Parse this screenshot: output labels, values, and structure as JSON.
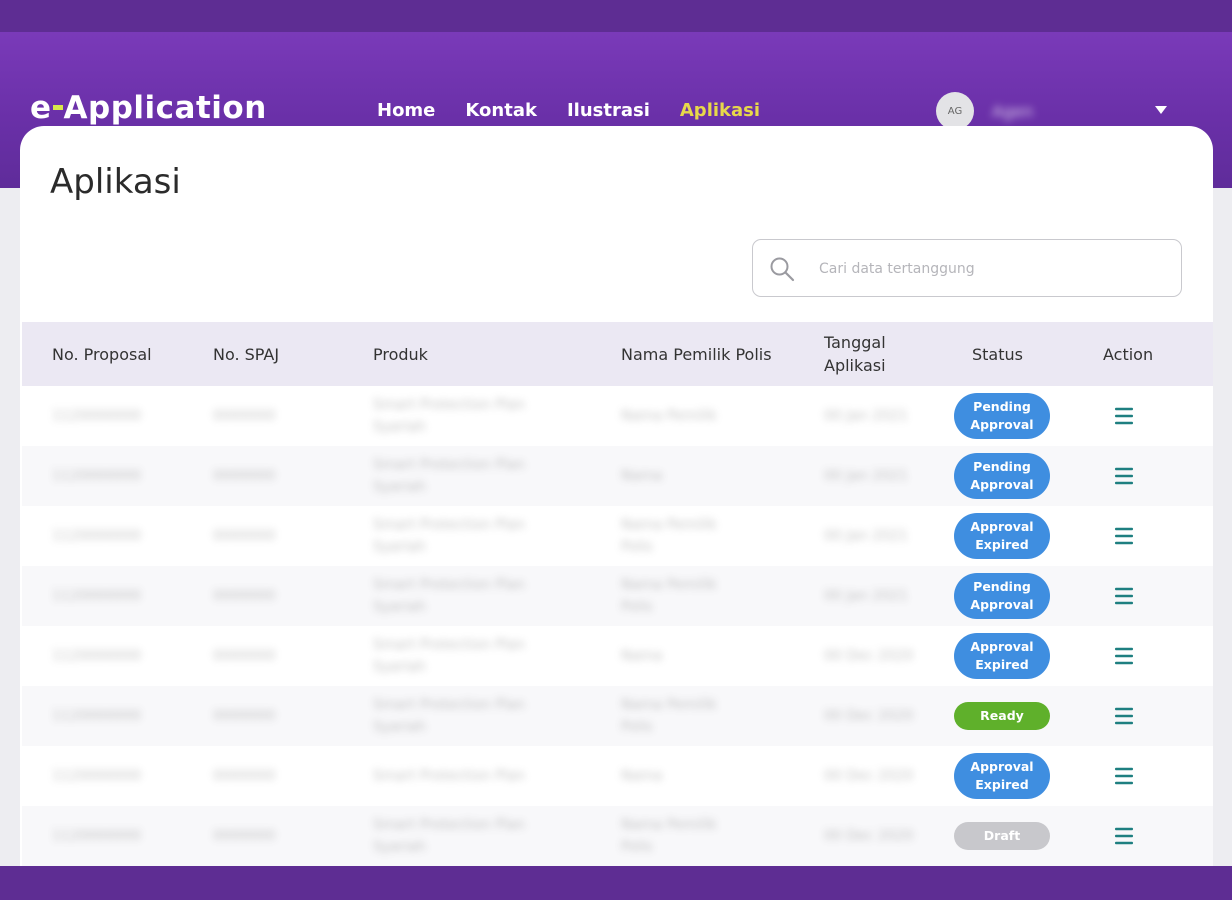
{
  "app": {
    "logo_prefix": "e",
    "logo_suffix": "Application"
  },
  "nav": {
    "items": [
      {
        "label": "Home",
        "active": false
      },
      {
        "label": "Kontak",
        "active": false
      },
      {
        "label": "Ilustrasi",
        "active": false
      },
      {
        "label": "Aplikasi",
        "active": true
      }
    ]
  },
  "user": {
    "initials": "AG",
    "name": "Agen"
  },
  "page": {
    "title": "Aplikasi"
  },
  "search": {
    "placeholder": "Cari data tertanggung",
    "value": ""
  },
  "table": {
    "headers": [
      "No. Proposal",
      "No. SPAJ",
      "Produk",
      "Nama Pemilik Polis",
      "Tanggal\nAplikasi",
      "Status",
      "Action"
    ],
    "rows": [
      {
        "proposal": "1120000000",
        "spaj": "0000000",
        "produk": "Smart Protection Plan\nSyariah",
        "pemilik": "Nama Pemilik",
        "tanggal": "00 Jan 2021",
        "status": "Pending\nApproval",
        "status_type": "pending"
      },
      {
        "proposal": "1120000000",
        "spaj": "0000000",
        "produk": "Smart Protection Plan\nSyariah",
        "pemilik": "Nama",
        "tanggal": "00 Jan 2021",
        "status": "Pending\nApproval",
        "status_type": "pending"
      },
      {
        "proposal": "1120000000",
        "spaj": "0000000",
        "produk": "Smart Protection Plan\nSyariah",
        "pemilik": "Nama Pemilik\nPolis",
        "tanggal": "00 Jan 2021",
        "status": "Approval\nExpired",
        "status_type": "expired"
      },
      {
        "proposal": "1120000000",
        "spaj": "0000000",
        "produk": "Smart Protection Plan\nSyariah",
        "pemilik": "Nama Pemilik\nPolis",
        "tanggal": "00 Jan 2021",
        "status": "Pending\nApproval",
        "status_type": "pending"
      },
      {
        "proposal": "1120000000",
        "spaj": "0000000",
        "produk": "Smart Protection Plan\nSyariah",
        "pemilik": "Nama",
        "tanggal": "00 Dec 2020",
        "status": "Approval\nExpired",
        "status_type": "expired"
      },
      {
        "proposal": "1120000000",
        "spaj": "0000000",
        "produk": "Smart Protection Plan\nSyariah",
        "pemilik": "Nama Pemilik\nPolis",
        "tanggal": "00 Dec 2020",
        "status": "Ready",
        "status_type": "ready"
      },
      {
        "proposal": "1120000000",
        "spaj": "0000000",
        "produk": "Smart Protection Plan",
        "pemilik": "Nama",
        "tanggal": "00 Dec 2020",
        "status": "Approval\nExpired",
        "status_type": "expired"
      },
      {
        "proposal": "1120000000",
        "spaj": "0000000",
        "produk": "Smart Protection Plan\nSyariah",
        "pemilik": "Nama Pemilik\nPolis",
        "tanggal": "00 Dec 2020",
        "status": "Draft",
        "status_type": "draft"
      }
    ]
  },
  "colors": {
    "brand_purple": "#6a30a8",
    "nav_active": "#e7d84a",
    "status_pending": "#3f8ee0",
    "status_expired": "#3f8ee0",
    "status_ready": "#5fb02b",
    "status_draft": "#c8c8cc",
    "action_icon": "#1e7f80"
  },
  "icons": {
    "search": "search-icon",
    "dropdown": "caret-down-icon",
    "action": "hamburger-menu-icon"
  }
}
